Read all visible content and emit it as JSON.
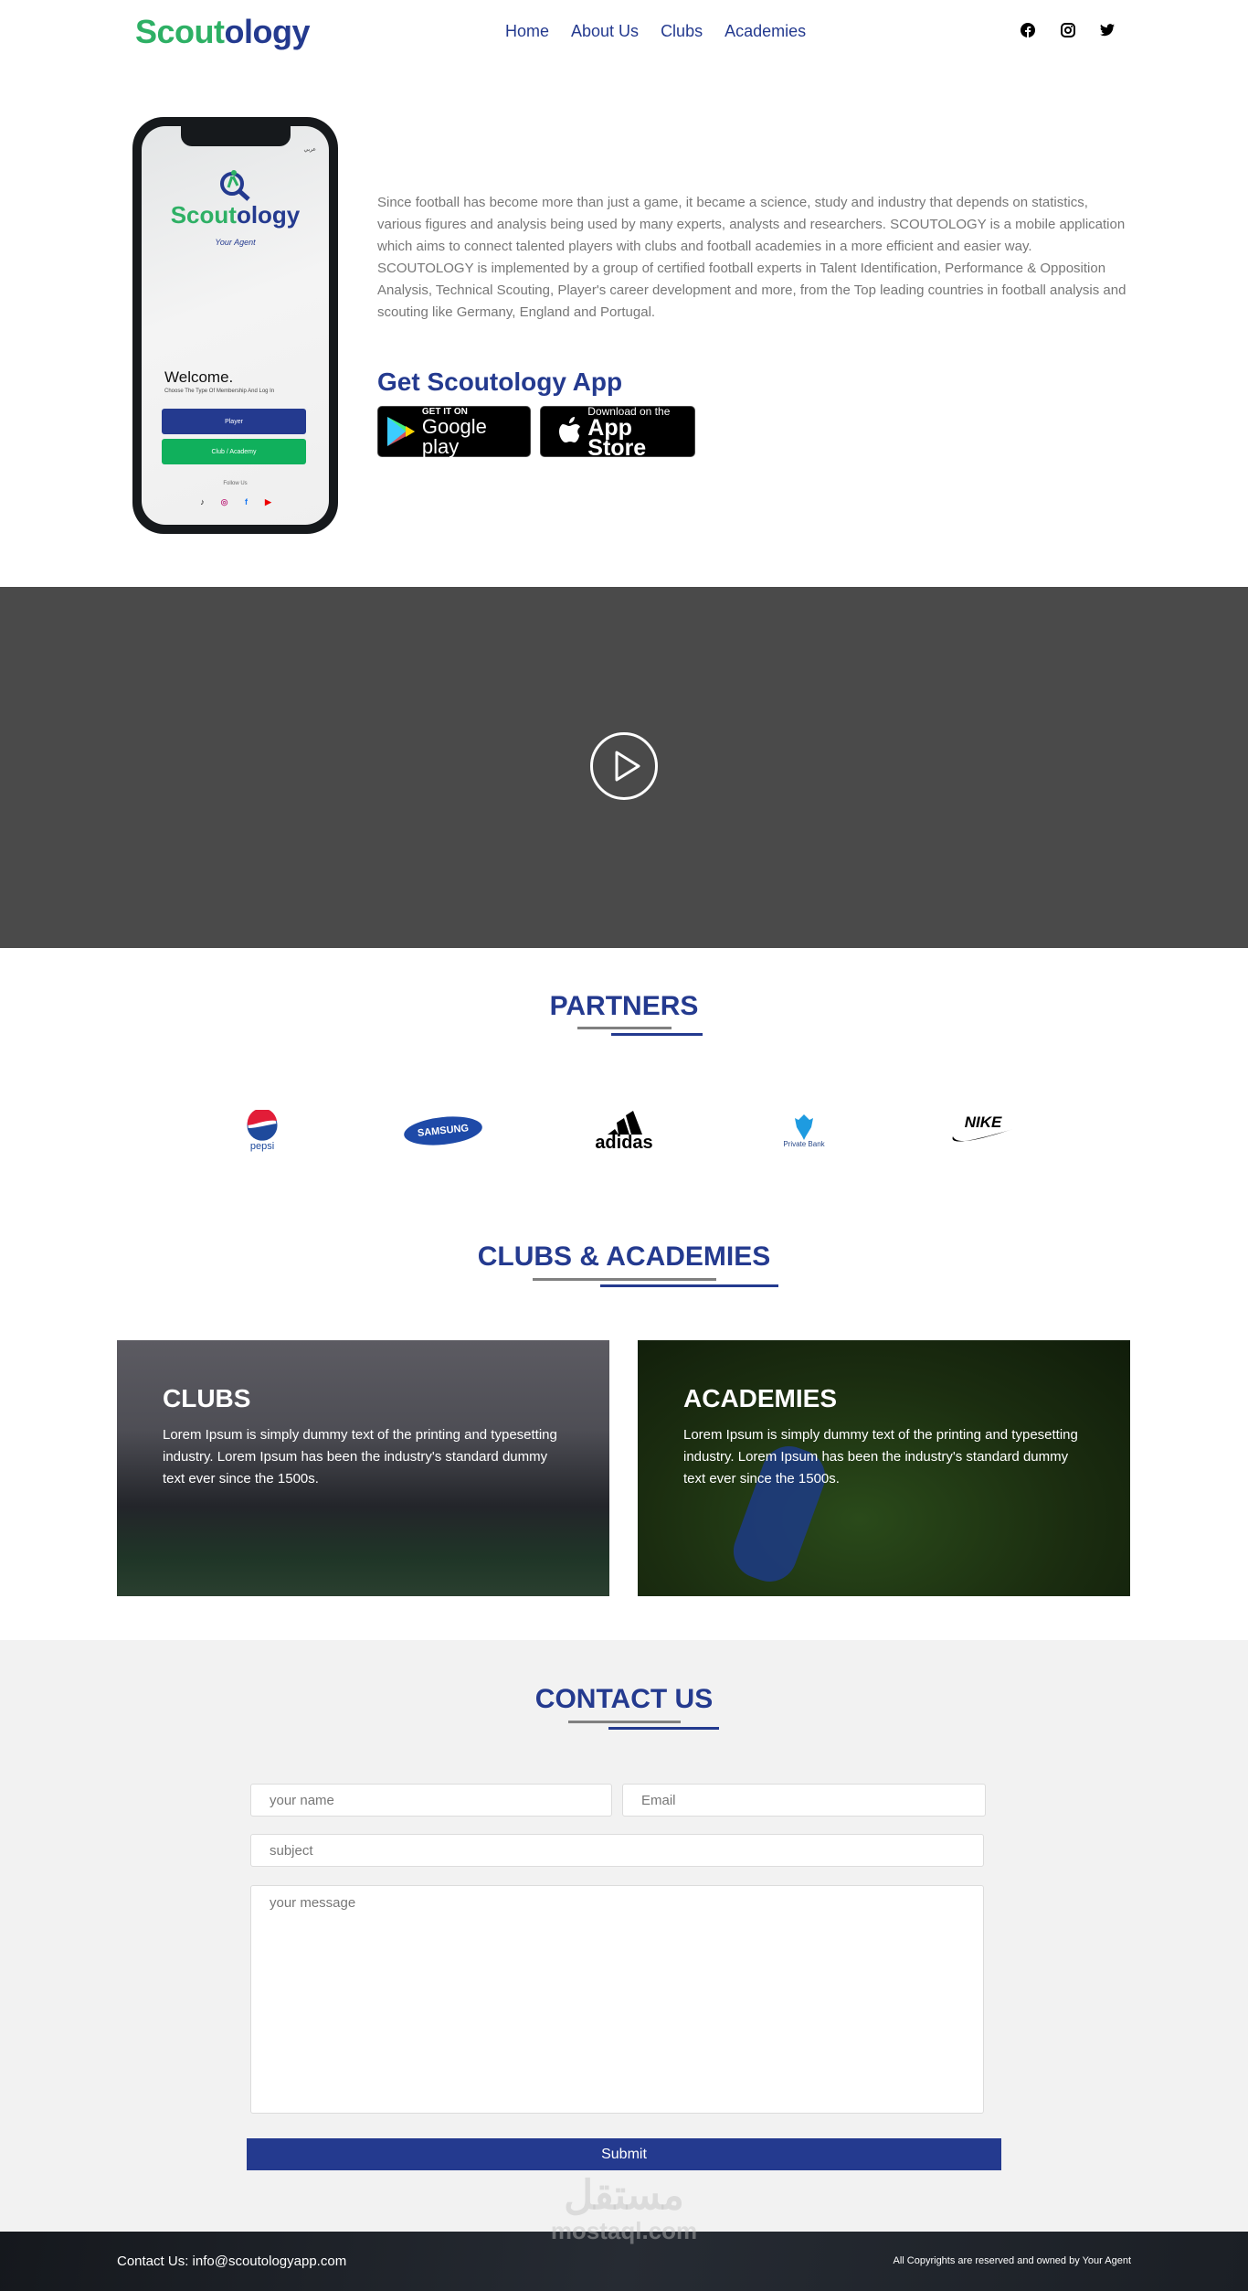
{
  "header": {
    "logo_part1": "Scout",
    "logo_part2": "ology",
    "nav": [
      "Home",
      "About Us",
      "Clubs",
      "Academies"
    ],
    "social_icons": [
      "facebook-icon",
      "instagram-icon",
      "twitter-icon"
    ]
  },
  "phone": {
    "language": "عربي",
    "logo_part1": "Scout",
    "logo_part2": "ology",
    "tagline": "Your Agent",
    "welcome": "Welcome.",
    "subtitle": "Choose The Type Of Membership And Log In",
    "player_btn": "Player",
    "club_btn": "Club / Academy",
    "follow": "Follow Us"
  },
  "about": {
    "text": "Since football has become more than just a game, it became a science, study and industry that depends on statistics, various figures and analysis being used by many experts, analysts and researchers. SCOUTOLOGY is a mobile application which aims to connect talented players with clubs and football academies in a more efficient and easier way. SCOUTOLOGY is implemented by a group of certified football experts in Talent Identification, Performance & Opposition Analysis, Technical Scouting, Player's career development and more, from the Top leading countries in football analysis and scouting like Germany, England and Portugal.",
    "app_title": "Get Scoutology App",
    "google_small": "GET IT ON",
    "google_big": "Google play",
    "apple_small": "Download on the",
    "apple_big": "App Store"
  },
  "partners": {
    "title": "PARTNERS",
    "logos": [
      "pepsi",
      "SAMSUNG",
      "adidas",
      "Private Bank",
      "NIKE"
    ]
  },
  "clubs": {
    "title": "CLUBS & ACADEMIES",
    "cards": [
      {
        "title": "CLUBS",
        "text": "Lorem Ipsum is simply dummy text of the printing and typesetting industry. Lorem Ipsum has been the industry's standard dummy text ever since the 1500s."
      },
      {
        "title": "ACADEMIES",
        "text": "Lorem Ipsum is simply dummy text of the printing and typesetting industry. Lorem Ipsum has been the industry's standard dummy text ever since the 1500s."
      }
    ]
  },
  "contact": {
    "title": "CONTACT US",
    "name_placeholder": "your name",
    "email_placeholder": "Email",
    "subject_placeholder": "subject",
    "message_placeholder": "your message",
    "submit": "Submit"
  },
  "watermark": {
    "arabic": "مستقل",
    "latin": "mostaql.com"
  },
  "footer": {
    "contact": "Contact Us: info@scoutologyapp.com",
    "copyright": "All Copyrights are reserved and owned by Your Agent"
  },
  "colors": {
    "brand_blue": "#243a8f",
    "brand_green": "#2eb065"
  }
}
